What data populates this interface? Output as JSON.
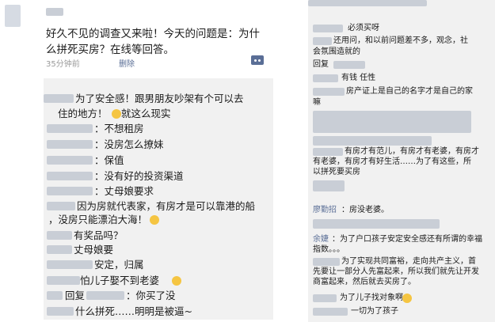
{
  "post": {
    "line1": "好久不见的调查又来啦！今天的问题是：为什",
    "line2": "么拼死买房？在线等回答。",
    "time": "35分钟前",
    "delete_label": "删除"
  },
  "comments": {
    "c1": "为了安全感！跟男朋友吵架有个可以去",
    "c2": "住的地方！",
    "c3": "就这么现实",
    "c4": "：不想租房",
    "c5": "：没房怎么撩妹",
    "c6": "：保值",
    "c7": "：没有好的投资渠道",
    "c8": "：丈母娘要求",
    "c9": "因为房就代表家，有房才是可以靠港的船",
    "c10": "，没房只能漂泊大海！",
    "c11": "有奖品吗？",
    "c12": "丈母娘要",
    "c13": "安定，归属",
    "c14": "怕儿子娶不到老婆",
    "c15_prefix": "回复",
    "c15": "：你买了没",
    "c16": "什么拼死……明明是被逼~"
  },
  "right": {
    "r1": "必须买呀",
    "r2": "还用问，和以前问题差不多，观念，社",
    "r3": "会氛围造就的",
    "r4": "回复",
    "r5": "有钱 任性",
    "r6": "房产证上是自己的名字才是自己的家",
    "r7": "嘛",
    "r8": "有房才有范儿，有房才有老婆，有房才",
    "r9": "有老婆，有房才有好生活……为了有这些，所",
    "r10": "以拼死要买房",
    "r11_name": "廖勤招",
    "r11": "：房没老婆。",
    "r12_name": "余婕",
    "r12": "：为了户口孩子安定安全感还有所谓的幸福",
    "r13": "指数。。。",
    "r14": "为了实现共同富裕，走向共产主义，首",
    "r15": "先要让一部分人先富起来，所以我们就先让开发",
    "r16": "商富起来，然后就去买房了。",
    "r17": "为了儿子找对象啊",
    "r18": "一切为了孩子"
  },
  "colors": {
    "link": "#5a6e96",
    "comment_bg": "#f1f1f1",
    "blur": "#c9ced6"
  }
}
